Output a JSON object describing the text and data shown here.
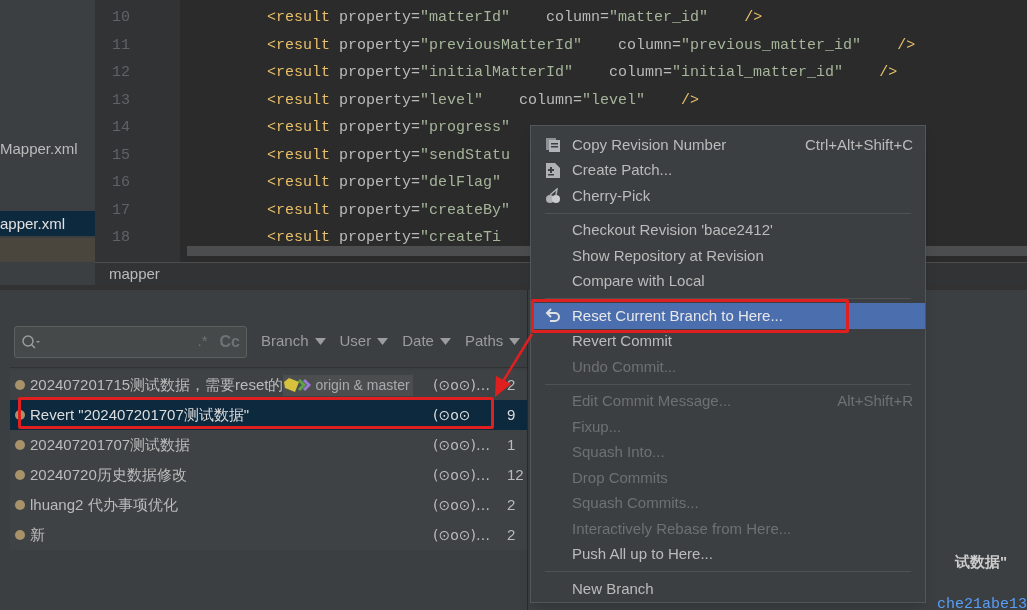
{
  "project_tree": {
    "items": [
      {
        "name": "Mapper.xml",
        "selected": false
      },
      {
        "name": "apper.xml",
        "selected": true
      }
    ]
  },
  "editor": {
    "lines": [
      {
        "number": "10",
        "code": "<result property=\"matterId\"    column=\"matter_id\"    />"
      },
      {
        "number": "11",
        "code": "<result property=\"previousMatterId\"    column=\"previous_matter_id\"    />"
      },
      {
        "number": "12",
        "code": "<result property=\"initialMatterId\"    column=\"initial_matter_id\"    />"
      },
      {
        "number": "13",
        "code": "<result property=\"level\"    column=\"level\"    />"
      },
      {
        "number": "14",
        "code": "<result property=\"progress\""
      },
      {
        "number": "15",
        "code": "<result property=\"sendStatu"
      },
      {
        "number": "16",
        "code": "<result property=\"delFlag\""
      },
      {
        "number": "17",
        "code": "<result property=\"createBy\""
      },
      {
        "number": "18",
        "code": "<result property=\"createTi"
      }
    ],
    "breadcrumb": "mapper"
  },
  "git_log": {
    "search": {
      "regex_toggle": ".*",
      "case_toggle": "Cc"
    },
    "filters": [
      "Branch",
      "User",
      "Date",
      "Paths"
    ],
    "commits": [
      {
        "message": "202407201715测试数据，需要reset的",
        "refs": "origin & master",
        "author": "(⊙o⊙)…",
        "date": "2",
        "selected": false
      },
      {
        "message": "Revert \"202407201707测试数据\"",
        "author": "(⊙o⊙",
        "date": "9",
        "selected": true
      },
      {
        "message": "202407201707测试数据",
        "author": "(⊙o⊙)…",
        "date": "1",
        "selected": false
      },
      {
        "message": "20240720历史数据修改",
        "author": "(⊙o⊙)…",
        "date": "12",
        "selected": false
      },
      {
        "message": "lhuang2 代办事项优化",
        "author": "(⊙o⊙)…",
        "date": "2",
        "selected": false
      },
      {
        "message": "新",
        "author": "(⊙o⊙)…",
        "date": "2",
        "selected": false
      }
    ]
  },
  "details": {
    "message": "试数据\"",
    "hash": "che21abe13"
  },
  "context_menu": {
    "items": [
      {
        "kind": "item",
        "label": "Copy Revision Number",
        "shortcut": "Ctrl+Alt+Shift+C",
        "disabled": false,
        "selected": false
      },
      {
        "kind": "item",
        "label": "Create Patch...",
        "disabled": false,
        "selected": false
      },
      {
        "kind": "item",
        "label": "Cherry-Pick",
        "disabled": false,
        "selected": false
      },
      {
        "kind": "separator"
      },
      {
        "kind": "item",
        "label": "Checkout Revision 'bace2412'",
        "disabled": false,
        "selected": false
      },
      {
        "kind": "item",
        "label": "Show Repository at Revision",
        "disabled": false,
        "selected": false
      },
      {
        "kind": "item",
        "label": "Compare with Local",
        "disabled": false,
        "selected": false
      },
      {
        "kind": "separator"
      },
      {
        "kind": "item",
        "label": "Reset Current Branch to Here...",
        "disabled": false,
        "selected": true
      },
      {
        "kind": "item",
        "label": "Revert Commit",
        "disabled": false,
        "selected": false
      },
      {
        "kind": "item",
        "label": "Undo Commit...",
        "disabled": true,
        "selected": false
      },
      {
        "kind": "separator"
      },
      {
        "kind": "item",
        "label": "Edit Commit Message...",
        "shortcut": "Alt+Shift+R",
        "disabled": true,
        "selected": false
      },
      {
        "kind": "item",
        "label": "Fixup...",
        "disabled": true,
        "selected": false
      },
      {
        "kind": "item",
        "label": "Squash Into...",
        "disabled": true,
        "selected": false
      },
      {
        "kind": "item",
        "label": "Drop Commits",
        "disabled": true,
        "selected": false
      },
      {
        "kind": "item",
        "label": "Squash Commits...",
        "disabled": true,
        "selected": false
      },
      {
        "kind": "item",
        "label": "Interactively Rebase from Here...",
        "disabled": true,
        "selected": false
      },
      {
        "kind": "item",
        "label": "Push All up to Here...",
        "disabled": false,
        "selected": false
      },
      {
        "kind": "separator"
      },
      {
        "kind": "item",
        "label": "New Branch",
        "disabled": false,
        "selected": false
      }
    ]
  }
}
